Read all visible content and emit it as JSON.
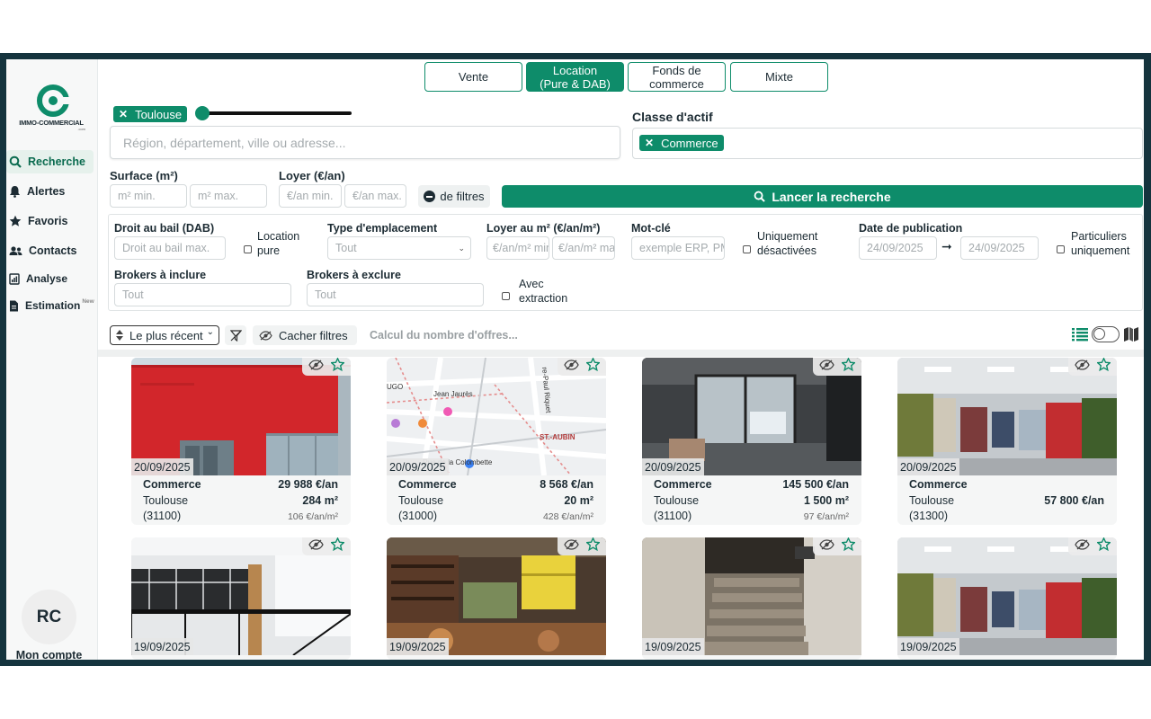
{
  "brand": {
    "name": "IMMO-COMMERCIAL",
    "suffix": ".com",
    "color": "#0e8c6a"
  },
  "nav": [
    {
      "label": "Recherche",
      "icon": "search-icon",
      "active": true
    },
    {
      "label": "Alertes",
      "icon": "bell-icon"
    },
    {
      "label": "Favoris",
      "icon": "star-icon"
    },
    {
      "label": "Contacts",
      "icon": "users-icon"
    },
    {
      "label": "Analyse",
      "icon": "chart-icon"
    },
    {
      "label": "Estimation",
      "icon": "document-icon",
      "badge": "New"
    }
  ],
  "account": {
    "initials": "RC",
    "label": "Mon compte"
  },
  "tabs": [
    {
      "label": "Vente"
    },
    {
      "label": "Location\n(Pure & DAB)",
      "active": true
    },
    {
      "label": "Fonds de\ncommerce"
    },
    {
      "label": "Mixte"
    }
  ],
  "location": {
    "chip": "Toulouse",
    "placeholder": "Région, département, ville ou adresse..."
  },
  "asset_class": {
    "label": "Classe d'actif",
    "chip": "Commerce"
  },
  "surface": {
    "label": "Surface (m²)",
    "min_placeholder": "m² min.",
    "max_placeholder": "m² max."
  },
  "rent": {
    "label": "Loyer (€/an)",
    "min_placeholder": "€/an min.",
    "max_placeholder": "€/an max."
  },
  "filters_toggle": "de filtres",
  "search_button": "Lancer la recherche",
  "advanced": {
    "droit_bail": {
      "label": "Droit au bail (DAB)",
      "placeholder": "Droit au bail max."
    },
    "location_pure": "Location\npure",
    "emplacement": {
      "label": "Type d'emplacement",
      "value": "Tout"
    },
    "loyer_m2": {
      "label": "Loyer au m² (€/an/m²)",
      "min_placeholder": "€/an/m² min",
      "max_placeholder": "€/an/m² max"
    },
    "mot_cle": {
      "label": "Mot-clé",
      "placeholder": "exemple ERP, PMR"
    },
    "desactivees": "Uniquement\ndésactivées",
    "date_pub": {
      "label": "Date de publication",
      "from": "24/09/2025",
      "to": "24/09/2025"
    },
    "particuliers": "Particuliers\nuniquement",
    "brokers_in": {
      "label": "Brokers à inclure",
      "placeholder": "Tout"
    },
    "brokers_out": {
      "label": "Brokers à exclure",
      "placeholder": "Tout"
    },
    "extraction": "Avec\nextraction"
  },
  "toolbar": {
    "sort": "Le plus récent",
    "hide_filters": "Cacher filtres",
    "count": "Calcul du nombre d'offres..."
  },
  "listings": [
    {
      "date": "20/09/2025",
      "type": "Commerce",
      "price": "29 988 €/an",
      "city": "Toulouse",
      "area": "284 m²",
      "zip": "(31100)",
      "ppm": "106 €/an/m²",
      "photo": "red-building"
    },
    {
      "date": "20/09/2025",
      "type": "Commerce",
      "price": "8 568 €/an",
      "city": "Toulouse",
      "area": "20 m²",
      "zip": "(31000)",
      "ppm": "428 €/an/m²",
      "photo": "map",
      "map_labels": [
        "Jean Jaurès",
        "Rue de la Colombette",
        "ST.-AUBIN",
        "re-Paul Riquet",
        "UGO"
      ]
    },
    {
      "date": "20/09/2025",
      "type": "Commerce",
      "price": "145 500 €/an",
      "city": "Toulouse",
      "area": "1 500 m²",
      "zip": "(31100)",
      "ppm": "97 €/an/m²",
      "photo": "store-interior"
    },
    {
      "date": "20/09/2025",
      "type": "Commerce",
      "price": "57 800 €/an",
      "city": "Toulouse",
      "area": "",
      "zip": "(31300)",
      "ppm": "",
      "photo": "clothing-store"
    },
    {
      "date": "19/09/2025",
      "photo": "loft-office"
    },
    {
      "date": "19/09/2025",
      "photo": "wine-shop"
    },
    {
      "date": "19/09/2025",
      "photo": "stairway"
    },
    {
      "date": "19/09/2025",
      "photo": "clothing-store"
    }
  ]
}
